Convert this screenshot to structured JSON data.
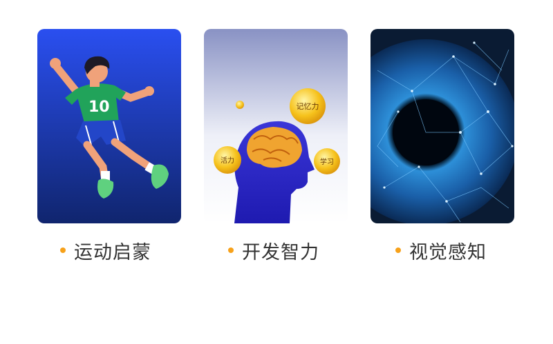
{
  "cards": [
    {
      "caption": "运动启蒙",
      "bullet_color": "#f7a11a",
      "image": "running-boy-illustration",
      "jersey_number": "10"
    },
    {
      "caption": "开发智力",
      "bullet_color": "#f7a11a",
      "image": "human-head-brain",
      "bubbles": [
        "记忆力",
        "活力",
        "学习"
      ]
    },
    {
      "caption": "视觉感知",
      "bullet_color": "#f7a11a",
      "image": "eye-iris-network"
    }
  ]
}
